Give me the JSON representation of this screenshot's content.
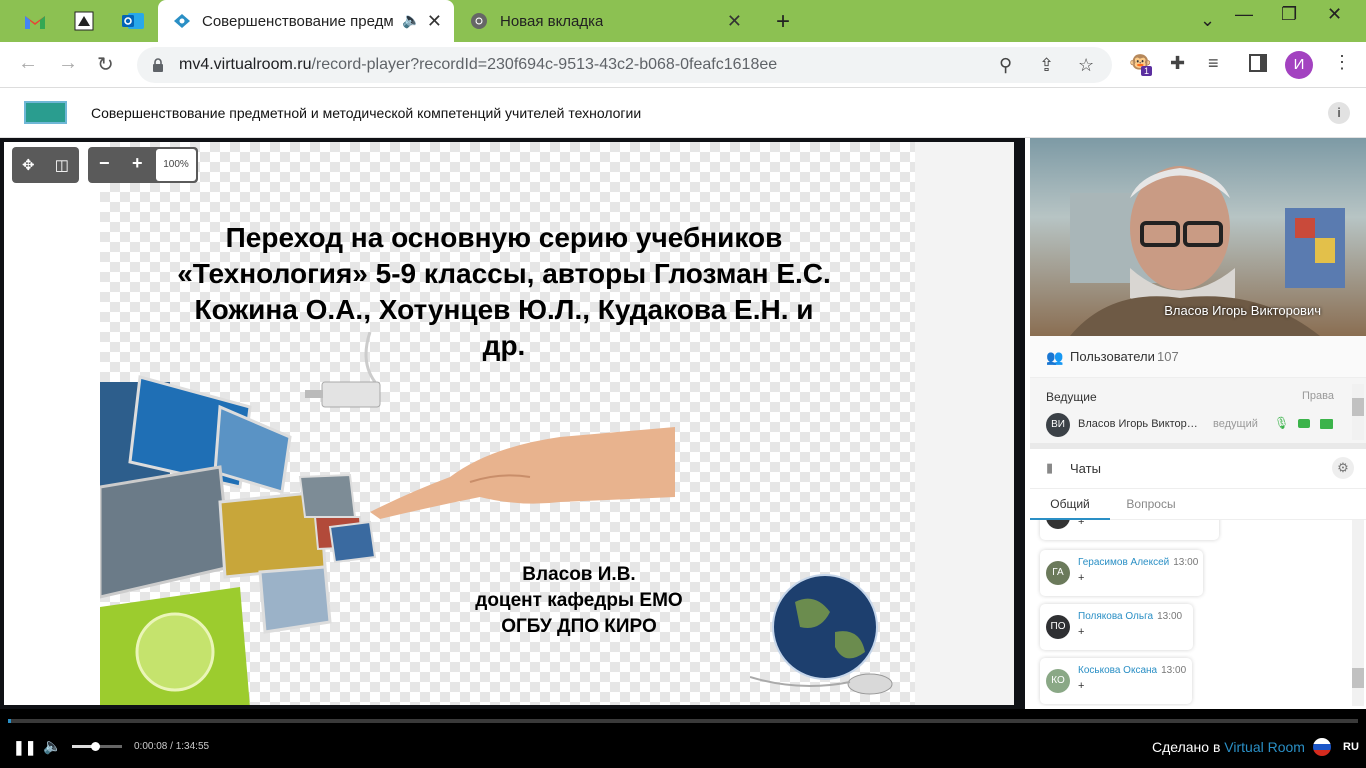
{
  "browser": {
    "tabs": [
      {
        "title": "Совершенствование предм",
        "active": true
      },
      {
        "title": "Новая вкладка",
        "active": false
      }
    ],
    "new_tab": "+",
    "url_host": "mv4.virtualroom.ru",
    "url_path": "/record-player?recordId=230f694c-9513-43c2-b068-0feafc1618ee",
    "profile_initial": "И",
    "ext_badge": "1",
    "window_controls": [
      "⌄",
      "—",
      "❐",
      "✕"
    ]
  },
  "app": {
    "title": "Совершенствование предметной и методической компетенций учителей технологии",
    "info": "i"
  },
  "viewer": {
    "zoom": "100%",
    "zoom_out": "−",
    "zoom_in": "+"
  },
  "slide": {
    "title_lines": [
      "Переход на основную серию учебников",
      "«Технология» 5-9 классы, авторы Глозман Е.С.",
      "Кожина О.А., Хотунцев Ю.Л., Кудакова Е.Н. и",
      "др."
    ],
    "author_lines": [
      "Власов И.В.",
      "доцент кафедры ЕМО",
      "ОГБУ ДПО КИРО"
    ]
  },
  "video": {
    "speaker": "Власов Игорь Викторович"
  },
  "users": {
    "label": "Пользователи",
    "count": "107",
    "presenters_label": "Ведущие",
    "rights_label": "Права",
    "presenter": {
      "initials": "ВИ",
      "name": "Власов Игорь Виктор…",
      "role": "ведущий"
    }
  },
  "chats": {
    "label": "Чаты",
    "tabs": [
      "Общий",
      "Вопросы"
    ],
    "messages": [
      {
        "initials": "ГА",
        "name": "Герасимов Алексей",
        "time": "13:00",
        "text": "+",
        "color": "#6b7a5b"
      },
      {
        "initials": "ПО",
        "name": "Полякова Ольга",
        "time": "13:00",
        "text": "+",
        "color": "#2f3033"
      },
      {
        "initials": "КО",
        "name": "Коськова Оксана",
        "time": "13:00",
        "text": "+",
        "color": "#8aa886"
      }
    ],
    "partial_text": "+"
  },
  "player": {
    "current": "0:00:08",
    "duration": "1:34:55",
    "time_text": "0:00:08 / 1:34:55",
    "progress": 0.0014,
    "volume": 0.45,
    "made_prefix": "Сделано в",
    "made_brand": "Virtual Room",
    "lang": "RU"
  }
}
